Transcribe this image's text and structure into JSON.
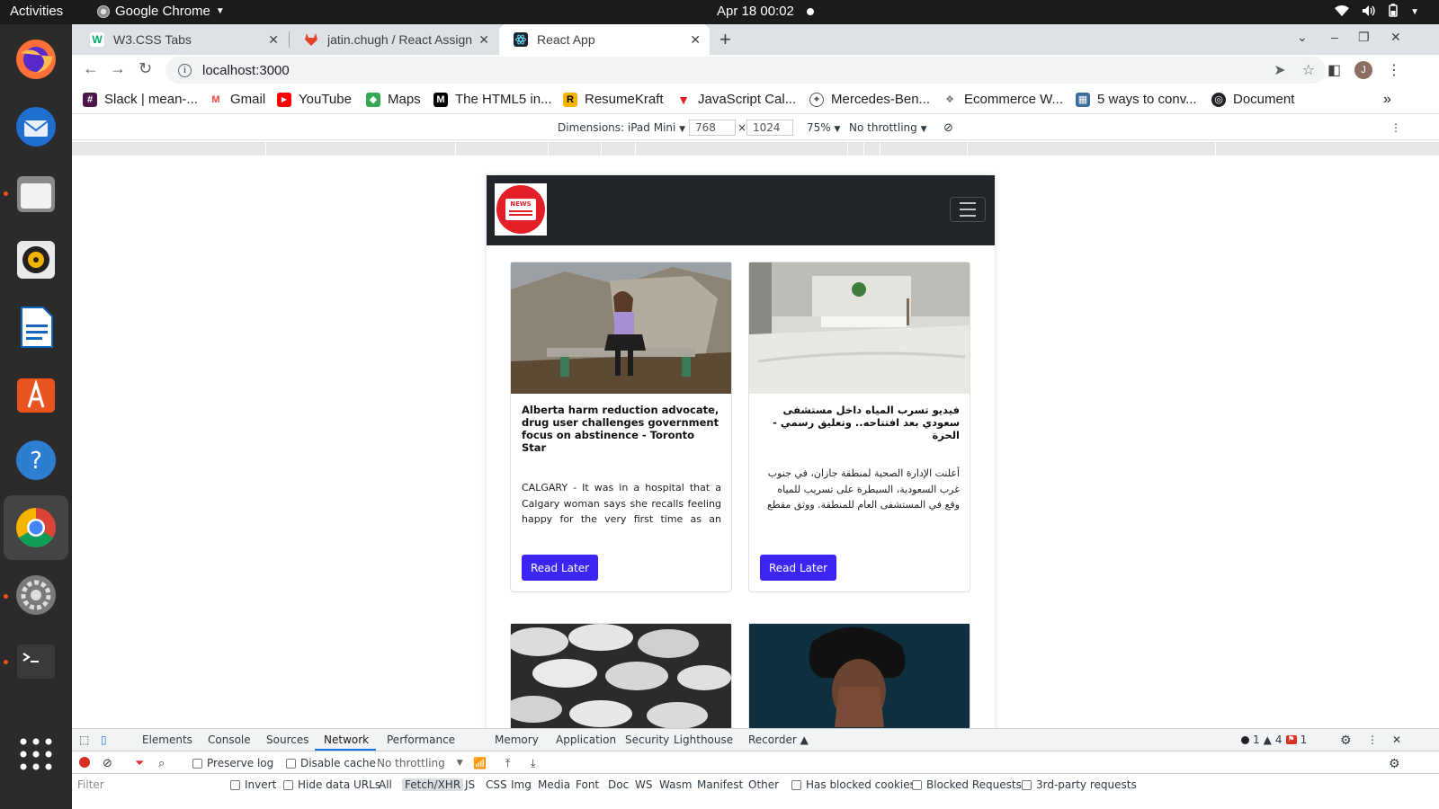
{
  "topbar": {
    "activities": "Activities",
    "app_name": "Google Chrome",
    "clock": "Apr 18  00:02"
  },
  "tabs": [
    {
      "title": "W3.CSS Tabs",
      "favicon_color": "#04aa6d"
    },
    {
      "title": "jatin.chugh / React Assign",
      "favicon_color": "#e24329"
    },
    {
      "title": "React App",
      "favicon_color": "#222",
      "active": true
    }
  ],
  "toolbar": {
    "url": "localhost:3000",
    "avatar_letter": "J"
  },
  "bookmarks": [
    {
      "label": "Slack | mean-...",
      "color": "#4a154b"
    },
    {
      "label": "Gmail",
      "color": "#ea4335"
    },
    {
      "label": "YouTube",
      "color": "#ff0000"
    },
    {
      "label": "Maps",
      "color": "#34a853"
    },
    {
      "label": "The HTML5 in...",
      "color": "#000000"
    },
    {
      "label": "ResumeKraft",
      "color": "#f4b400"
    },
    {
      "label": "JavaScript Cal...",
      "color": "#e41e26"
    },
    {
      "label": "Mercedes-Ben...",
      "color": "#555555"
    },
    {
      "label": "Ecommerce W...",
      "color": "#777777"
    },
    {
      "label": "5 ways to conv...",
      "color": "#3b6e9e"
    },
    {
      "label": "Document",
      "color": "#202124"
    }
  ],
  "device_toolbar": {
    "dimensions_label": "Dimensions: iPad Mini",
    "width": "768",
    "height": "1024",
    "times": "×",
    "zoom": "75%",
    "throttle": "No throttling"
  },
  "app": {
    "logo_text": "NEWS",
    "cards": [
      {
        "title": "Alberta harm reduction advocate, drug user challenges government focus on abstinence - Toronto Star",
        "description": "CALGARY - It was in a hospital that a Calgary woman says she recalls feeling happy for the very first time as an opioid",
        "button": "Read Later",
        "rtl": false
      },
      {
        "title": "فيديو تسرب المياه داخل مستشفى سعودي بعد افتتاحه.. وتعليق رسمي - الحرة",
        "description": "أعلنت الإدارة الصحية لمنطقة جازان، في جنوب غرب السعودية، السيطرة على تسريب للمياه وقع في المستشفى العام للمنطقة. ووثق مقطع",
        "button": "Read Later",
        "rtl": true
      }
    ]
  },
  "devtools": {
    "tabs": [
      "Elements",
      "Console",
      "Sources",
      "Network",
      "Performance",
      "Memory",
      "Application",
      "Security",
      "Lighthouse",
      "Recorder"
    ],
    "active_tab": "Network",
    "issues": {
      "errors": "1",
      "warnings": "4",
      "flags": "1"
    },
    "network_toolbar": {
      "preserve_log": "Preserve log",
      "disable_cache": "Disable cache",
      "throttle": "No throttling"
    },
    "filter_bar": {
      "placeholder": "Filter",
      "invert": "Invert",
      "hide_data_urls": "Hide data URLs",
      "types": [
        "All",
        "Fetch/XHR",
        "JS",
        "CSS",
        "Img",
        "Media",
        "Font",
        "Doc",
        "WS",
        "Wasm",
        "Manifest",
        "Other"
      ],
      "selected_type": "Fetch/XHR",
      "has_blocked_cookies": "Has blocked cookies",
      "blocked_requests": "Blocked Requests",
      "third_party": "3rd-party requests"
    }
  }
}
